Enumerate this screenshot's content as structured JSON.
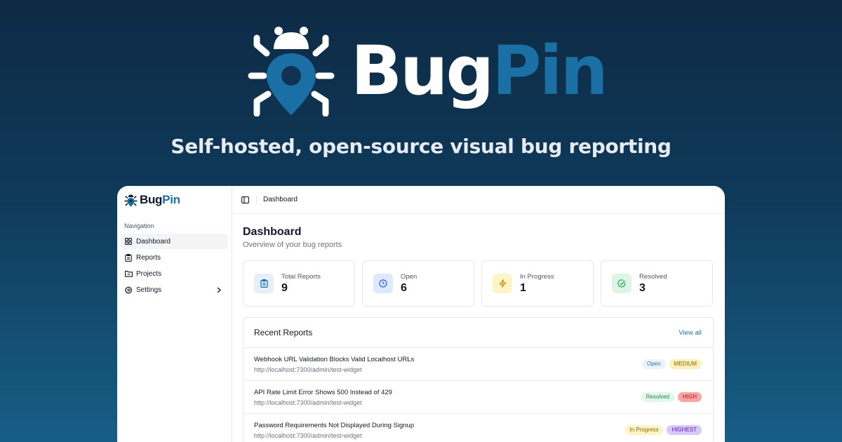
{
  "hero": {
    "brand_part1": "Bug",
    "brand_part2": "Pin",
    "tagline": "Self-hosted, open-source visual bug reporting"
  },
  "sidebar": {
    "brand_part1": "Bug",
    "brand_part2": "Pin",
    "nav_label": "Navigation",
    "items": [
      {
        "label": "Dashboard",
        "icon": "layout-grid-icon",
        "active": true
      },
      {
        "label": "Reports",
        "icon": "clipboard-icon"
      },
      {
        "label": "Projects",
        "icon": "folder-icon"
      },
      {
        "label": "Settings",
        "icon": "gear-icon",
        "has_submenu": true
      }
    ]
  },
  "topbar": {
    "breadcrumb": "Dashboard"
  },
  "page": {
    "title": "Dashboard",
    "subtitle": "Overview of your bug reports"
  },
  "stats": [
    {
      "label": "Total Reports",
      "value": "9",
      "icon": "clipboard-icon",
      "color": "#1a6fa5"
    },
    {
      "label": "Open",
      "value": "6",
      "icon": "clock-icon",
      "color": "#2563eb"
    },
    {
      "label": "In Progress",
      "value": "1",
      "icon": "lightning-icon",
      "color": "#ca8a04"
    },
    {
      "label": "Resolved",
      "value": "3",
      "icon": "check-circle-icon",
      "color": "#16a34a"
    }
  ],
  "recent": {
    "title": "Recent Reports",
    "view_all": "View all",
    "reports": [
      {
        "title": "Webhook URL Validation Blocks Valid Localhost URLs",
        "url": "http://localhost:7300/admin/test-widget",
        "status": "Open",
        "priority": "MEDIUM"
      },
      {
        "title": "API Rate Limit Error Shows 500 Instead of 429",
        "url": "http://localhost:7300/admin/test-widget",
        "status": "Resolved",
        "priority": "HIGH"
      },
      {
        "title": "Password Requirements Not Displayed During Signup",
        "url": "http://localhost:7300/admin/test-widget",
        "status": "In Progress",
        "priority": "HIGHEST"
      }
    ]
  },
  "colors": {
    "brand_accent": "#1a6fa5",
    "background_top": "#0d2a44",
    "background_bottom": "#175e86"
  }
}
